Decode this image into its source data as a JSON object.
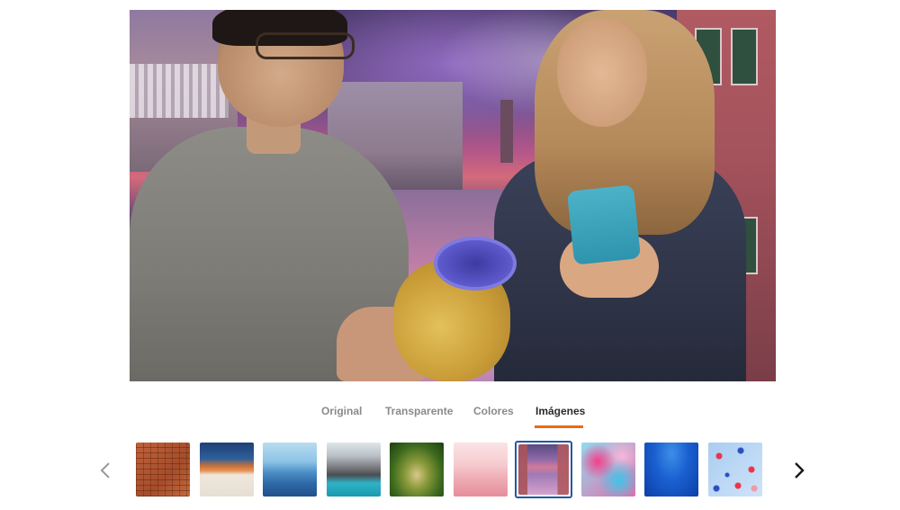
{
  "preview": {
    "icon": "edited-photo-preview"
  },
  "tabs": [
    {
      "label": "Original",
      "active": false
    },
    {
      "label": "Transparente",
      "active": false
    },
    {
      "label": "Colores",
      "active": false
    },
    {
      "label": "Imágenes",
      "active": true
    }
  ],
  "accent_color": "#ea6b12",
  "selected_color": "#1f5aa6",
  "carousel": {
    "prev_icon": "chevron-left-icon",
    "next_icon": "chevron-right-icon",
    "selected_index": 6,
    "thumbnails": [
      {
        "name": "brick-wall-background"
      },
      {
        "name": "desert-sunset-background"
      },
      {
        "name": "blue-mountains-background"
      },
      {
        "name": "mountain-lake-background"
      },
      {
        "name": "forest-path-background"
      },
      {
        "name": "pink-hills-background"
      },
      {
        "name": "venice-canal-background"
      },
      {
        "name": "abstract-paint-background"
      },
      {
        "name": "underwater-background"
      },
      {
        "name": "confetti-background"
      }
    ]
  }
}
